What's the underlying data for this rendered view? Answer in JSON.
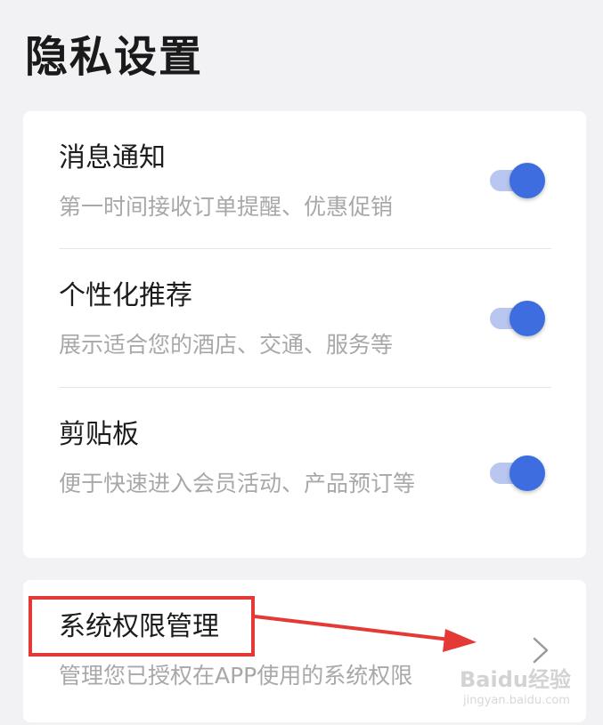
{
  "page": {
    "title": "隐私设置"
  },
  "settings": {
    "items": [
      {
        "title": "消息通知",
        "description": "第一时间接收订单提醒、优惠促销",
        "enabled": true
      },
      {
        "title": "个性化推荐",
        "description": "展示适合您的酒店、交通、服务等",
        "enabled": true
      },
      {
        "title": "剪贴板",
        "description": "便于快速进入会员活动、产品预订等",
        "enabled": true
      }
    ]
  },
  "permissions": {
    "title": "系统权限管理",
    "description": "管理您已授权在APP使用的系统权限",
    "chevron_icon": "chevron-right-icon"
  },
  "annotation": {
    "color": "#e53935"
  },
  "watermark": {
    "logo": "Baidu经验",
    "url": "jingyan.baidu.com"
  },
  "colors": {
    "toggle_on": "#3e6de0",
    "toggle_track": "#b9c6f0",
    "background": "#f2f2f4"
  }
}
